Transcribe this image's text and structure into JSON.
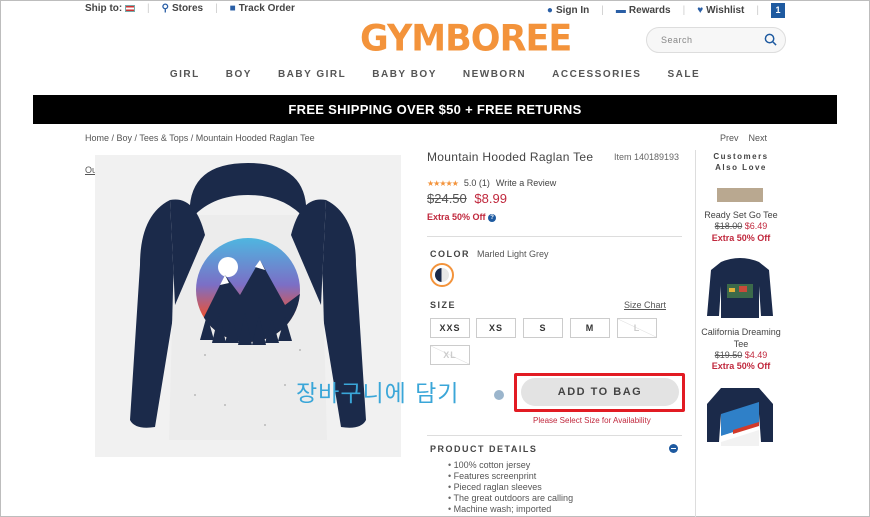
{
  "topbar": {
    "ship_to": "Ship to:",
    "stores": "Stores",
    "track_order": "Track Order",
    "sign_in": "Sign In",
    "rewards": "Rewards",
    "wishlist": "Wishlist",
    "bag_count": "1"
  },
  "brand": {
    "logo": "GYMBOREE"
  },
  "search": {
    "placeholder": "Search"
  },
  "nav": [
    "GIRL",
    "BOY",
    "BABY GIRL",
    "BABY BOY",
    "NEWBORN",
    "ACCESSORIES",
    "SALE"
  ],
  "banner": "FREE SHIPPING OVER $50 + FREE RETURNS",
  "breadcrumb": "Home / Boy / Tees & Tops / Mountain Hooded Raglan Tee",
  "pager": {
    "prev": "Prev",
    "next": "Next"
  },
  "outfit_link": "Outfit This",
  "product": {
    "title": "Mountain Hooded Raglan Tee",
    "item_no": "Item 140189193",
    "stars": "★★★★★",
    "rating": "5.0 (1)",
    "write_review": "Write a Review",
    "price_old": "$24.50",
    "price_new": "$8.99",
    "extra_off": "Extra 50% Off",
    "color_label": "COLOR",
    "color_value": "Marled Light Grey",
    "size_label": "SIZE",
    "size_chart": "Size Chart",
    "sizes": [
      "XXS",
      "XS",
      "S",
      "M",
      "L",
      "XL"
    ],
    "add_to_bag": "ADD TO BAG",
    "warning": "Please Select Size for Availability",
    "details_label": "PRODUCT DETAILS",
    "details": [
      "100% cotton jersey",
      "Features screenprint",
      "Pieced raglan sleeves",
      "The great outdoors are calling",
      "Machine wash; imported"
    ]
  },
  "annotation": "장바구니에 담기",
  "sidebar": {
    "title": "Customers Also Love",
    "items": [
      {
        "name": "Ready Set Go Tee",
        "old": "$18.00",
        "new": "$6.49",
        "off": "Extra 50% Off"
      },
      {
        "name": "California Dreaming Tee",
        "old": "$19.50",
        "new": "$4.49",
        "off": "Extra 50% Off"
      }
    ]
  },
  "colors": {
    "accent": "#f3933b",
    "sale": "#c0283d",
    "brand_blue": "#1e5aa0",
    "annotation_red": "#e21b23"
  }
}
